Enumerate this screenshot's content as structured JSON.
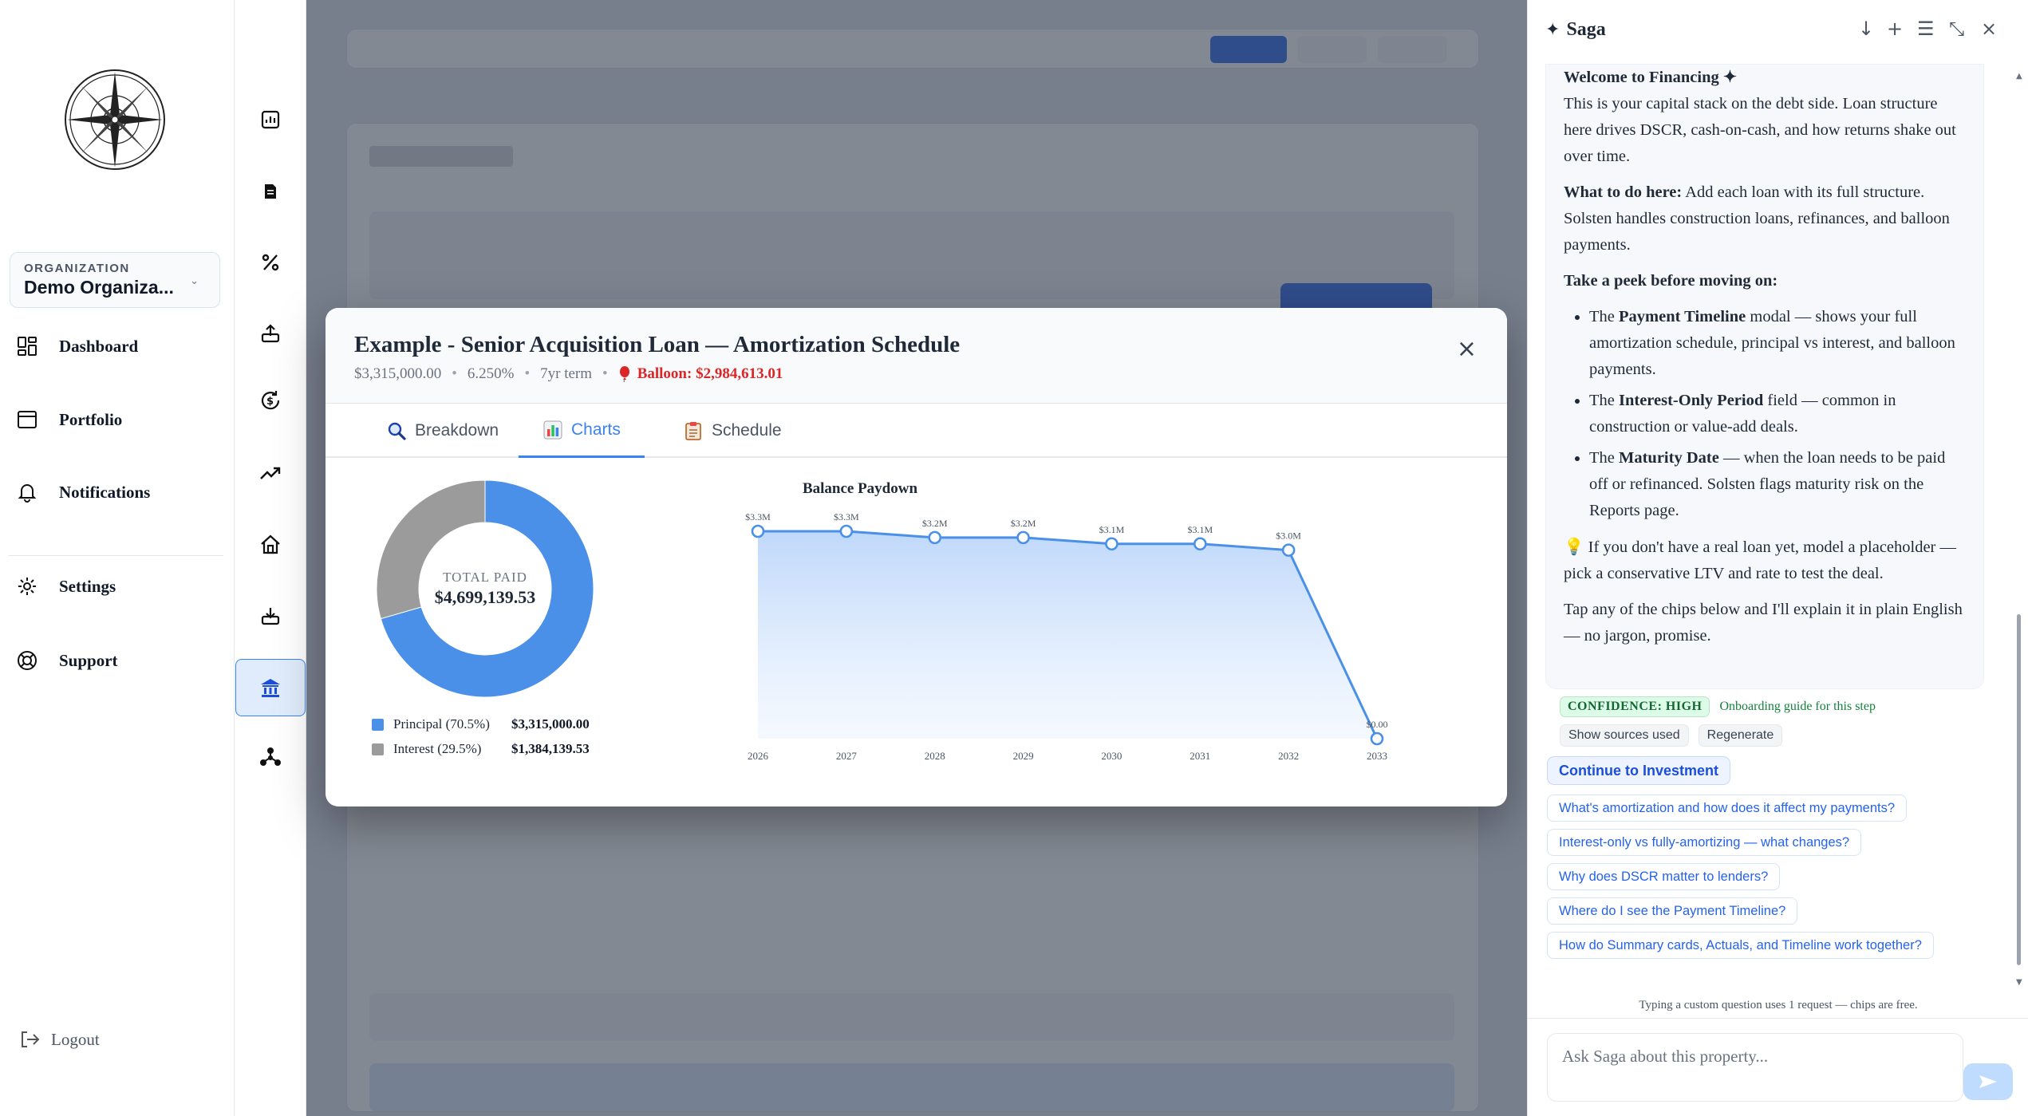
{
  "sidebar": {
    "org_label": "ORGANIZATION",
    "org_name": "Demo Organiza...",
    "items": [
      {
        "label": "Dashboard",
        "icon": "dashboard-icon"
      },
      {
        "label": "Portfolio",
        "icon": "window-icon"
      },
      {
        "label": "Notifications",
        "icon": "bell-icon"
      },
      {
        "label": "Settings",
        "icon": "gear-icon"
      },
      {
        "label": "Support",
        "icon": "lifebuoy-icon"
      }
    ],
    "logout_label": "Logout"
  },
  "rail": {
    "icons": [
      "bar-chart-icon",
      "document-icon",
      "percent-icon",
      "upload-tray-icon",
      "dollar-cycle-icon",
      "trend-up-icon",
      "house-icon",
      "download-tray-icon",
      "bank-icon",
      "network-icon"
    ],
    "active": "bank-icon"
  },
  "modal": {
    "title": "Example - Senior Acquisition Loan — Amortization Schedule",
    "amount": "$3,315,000.00",
    "rate": "6.250%",
    "term": "7yr term",
    "balloon": "Balloon: $2,984,613.01",
    "close": "×",
    "tabs": [
      {
        "label": "Breakdown",
        "icon": "magnifier-icon"
      },
      {
        "label": "Charts",
        "icon": "chart-icon",
        "active": true
      },
      {
        "label": "Schedule",
        "icon": "clipboard-icon"
      }
    ],
    "donut": {
      "center_label": "TOTAL PAID",
      "center_value": "$4,699,139.53",
      "legend": [
        {
          "label": "Principal (70.5%)",
          "value": "$3,315,000.00",
          "color": "#4a90e8"
        },
        {
          "label": "Interest (29.5%)",
          "value": "$1,384,139.53",
          "color": "#9b9b9b"
        }
      ]
    }
  },
  "chart_data": [
    {
      "type": "pie",
      "categories": [
        "Principal",
        "Interest"
      ],
      "values": [
        3315000.0,
        1384139.53
      ],
      "colors": [
        "#4a90e8",
        "#9b9b9b"
      ],
      "donut": true
    },
    {
      "type": "area",
      "title": "Balance Paydown",
      "categories": [
        "2026",
        "2027",
        "2028",
        "2029",
        "2030",
        "2031",
        "2032",
        "2033"
      ],
      "values": [
        3300000,
        3300000,
        3200000,
        3200000,
        3100000,
        3100000,
        3000000,
        0
      ],
      "data_labels": [
        "$3.3M",
        "$3.3M",
        "$3.2M",
        "$3.2M",
        "$3.1M",
        "$3.1M",
        "$3.0M",
        "$0.00"
      ],
      "color": "#4a90e8",
      "grid": false
    }
  ],
  "saga": {
    "title": "Saga",
    "header_buttons": [
      "↓",
      "+",
      "☰",
      "⤡",
      "×"
    ],
    "welcome": "Welcome to Financing ✦",
    "intro": "This is your capital stack on the debt side. Loan structure here drives DSCR, cash-on-cash, and how returns shake out over time.",
    "what_label": "What to do here:",
    "what_text": " Add each loan with its full structure. Solsten handles construction loans, refinances, and balloon payments.",
    "peek_label": "Take a peek before moving on:",
    "bullets": [
      {
        "pre": "The ",
        "bold": "Payment Timeline",
        "post": " modal — shows your full amortization schedule, principal vs interest, and balloon payments."
      },
      {
        "pre": "The ",
        "bold": "Interest-Only Period",
        "post": " field — common in construction or value-add deals."
      },
      {
        "pre": "The ",
        "bold": "Maturity Date",
        "post": " — when the loan needs to be paid off or refinanced. Solsten flags maturity risk on the Reports page."
      }
    ],
    "tip": " If you don't have a real loan yet, model a placeholder — pick a conservative LTV and rate to test the deal.",
    "closing": "Tap any of the chips below and I'll explain it in plain English — no jargon, promise.",
    "confidence": "CONFIDENCE: HIGH",
    "confidence_note": "Onboarding guide for this step",
    "sources_btn": "Show sources used",
    "regen_btn": "Regenerate",
    "continue_btn": "Continue to Investment",
    "chips": [
      "What's amortization and how does it affect my payments?",
      "Interest-only vs fully-amortizing — what changes?",
      "Why does DSCR matter to lenders?",
      "Where do I see the Payment Timeline?",
      "How do Summary cards, Actuals, and Timeline work together?"
    ],
    "foot_note": "Typing a custom question uses 1 request — chips are free.",
    "input_placeholder": "Ask Saga about this property..."
  },
  "colors": {
    "accent": "#3b82f6",
    "balloon": "#dc2626",
    "confidence_bg": "#dcfce7"
  }
}
